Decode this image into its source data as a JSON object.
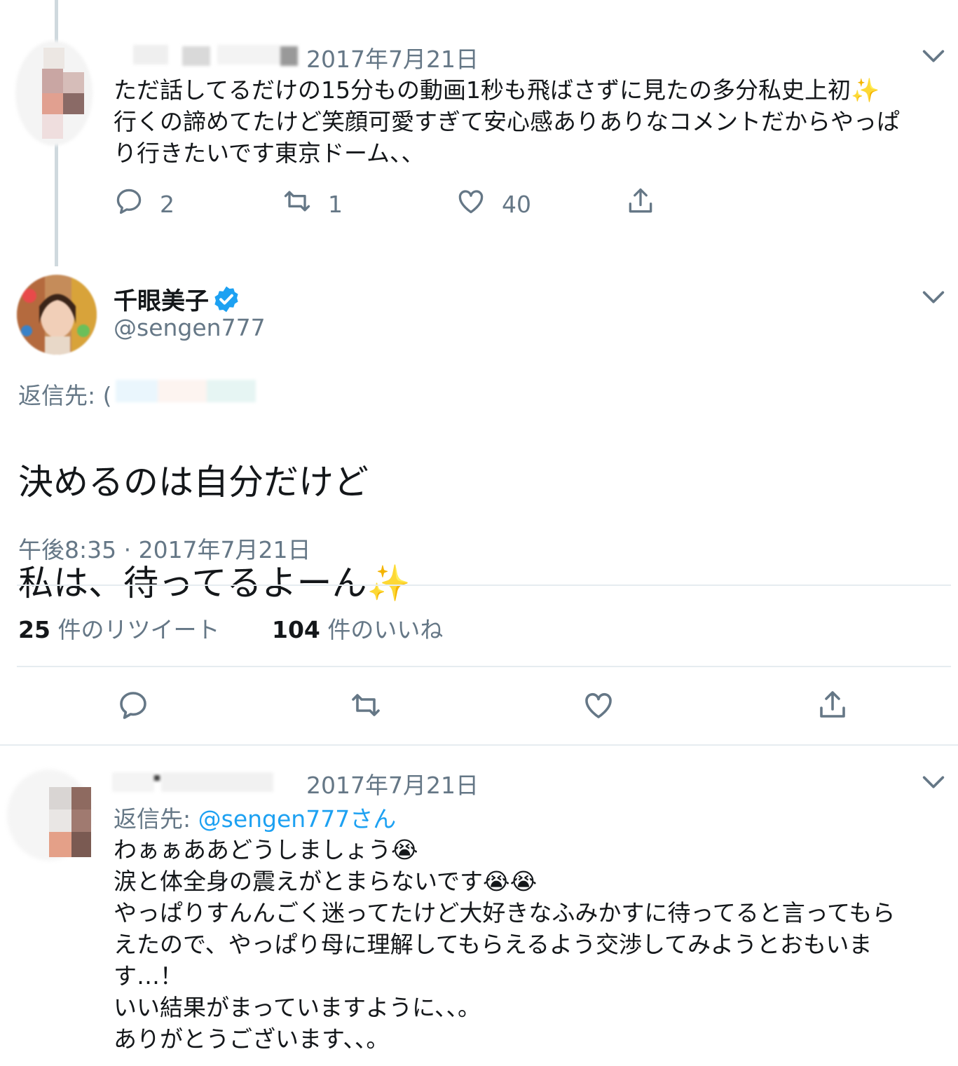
{
  "tweet1": {
    "date": "2017年7月21日",
    "text": "ただ話してるだけの15分もの動画1秒も飛ばさずに見たの多分私史上初✨\n行くの諦めてたけど笑顔可愛すぎて安心感ありありなコメントだからやっぱ\nり行きたいです東京ドーム、、",
    "replies": "2",
    "retweets": "1",
    "likes": "40"
  },
  "main_tweet": {
    "name": "千眼美子",
    "handle": "@sengen777",
    "reply_to_label": "返信先: (",
    "line1": "決めるのは自分だけど",
    "line2": "私は、待ってるよーん",
    "sparkle": "✨",
    "timestamp": "午後8:35 · 2017年7月21日",
    "retweet_count": "25",
    "retweet_label": "件のリツイート",
    "like_count": "104",
    "like_label": "件のいいね"
  },
  "tweet3": {
    "date": "2017年7月21日",
    "reply_prefix": "返信先:",
    "reply_handle": "@sengen777",
    "reply_suffix": "さん",
    "line1": "わぁぁああどうしましょう",
    "line2": "涙と体全身の震えがとまらないです",
    "line3": "やっぱりすんんごく迷ってたけど大好きなふみかすに待ってると言ってもら\nえたので、やっぱり母に理解してもらえるよう交渉してみようとおもいま\nす…！",
    "line4": "いい結果がまっていますように、、。",
    "line5": "ありがとうございます、、。",
    "crying_emoji": "😭"
  },
  "icons": {
    "reply": "reply-icon",
    "retweet": "retweet-icon",
    "like": "heart-icon",
    "share": "share-icon",
    "menu": "chevron-down-icon",
    "verified": "verified-badge-icon"
  },
  "colors": {
    "accent": "#1da1f2",
    "secondary_text": "#657786",
    "divider": "#e6ecf0"
  }
}
